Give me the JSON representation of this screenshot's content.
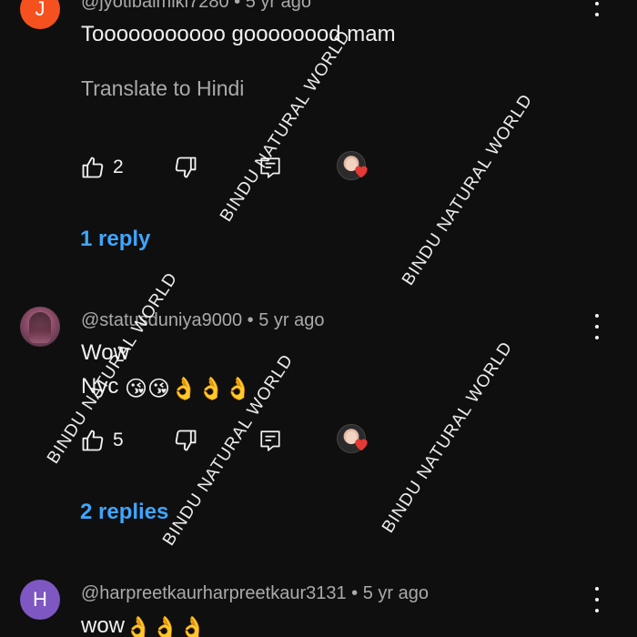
{
  "comments": [
    {
      "avatar_letter": "J",
      "avatar_color": "#f4511e",
      "handle": "@jyotibalmiki7280",
      "age": "5 yr ago",
      "lines": [
        "Tooooooooooo goooooood mam"
      ],
      "translate": "Translate to Hindi",
      "like_count": "2",
      "replies": "1 reply"
    },
    {
      "avatar": "photo",
      "handle": "@statusduniya9000",
      "age": "5 yr ago",
      "lines": [
        "Wow",
        "Nyc"
      ],
      "emojis": [
        "😘",
        "😘",
        "👌",
        "👌",
        "👌"
      ],
      "like_count": "5",
      "replies": "2 replies"
    },
    {
      "avatar_letter": "H",
      "avatar_color": "#7e57c2",
      "handle": "@harpreetkaurharpreetkaur3131",
      "age": "5 yr ago",
      "lines": [
        "wow"
      ],
      "emojis": [
        "👌",
        "👌",
        "👌"
      ]
    }
  ],
  "separator": "•",
  "watermark": "BINDU NATURAL WORLD",
  "colors": {
    "background": "#0f0f0f",
    "link": "#3ea6ff",
    "secondary_text": "#aaaaaa",
    "heart": "#e53935"
  },
  "icons": [
    "like-icon",
    "dislike-icon",
    "reply-icon",
    "creator-heart-icon",
    "more-options-icon"
  ]
}
